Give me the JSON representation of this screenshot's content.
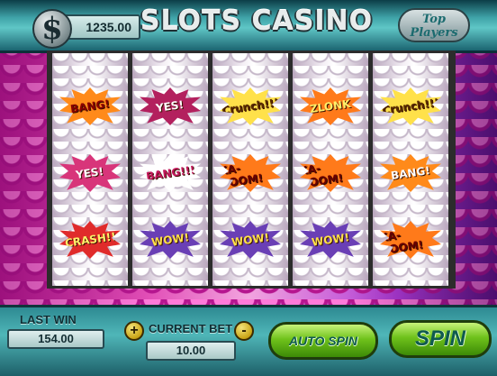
{
  "header": {
    "currency_symbol": "$",
    "balance": "1235.00",
    "title": "SLOTS CASINO",
    "top_players_line1": "Top",
    "top_players_line2": "Players"
  },
  "reels": [
    [
      {
        "text": "BANG!",
        "color": "#ff8a1a",
        "text_color": "#8a0000"
      },
      {
        "text": "YES!",
        "color": "#d8357a",
        "text_color": "#ffffff"
      },
      {
        "text": "CRASH!!",
        "color": "#e02b2b",
        "text_color": "#fff06a"
      }
    ],
    [
      {
        "text": "YES!",
        "color": "#b3205e",
        "text_color": "#ffffff"
      },
      {
        "text": "BANG!!!",
        "color": "#ffffff",
        "text_color": "#c2185b"
      },
      {
        "text": "WOW!",
        "color": "#6a3fb5",
        "text_color": "#ffe14a"
      }
    ],
    [
      {
        "text": "Crunch!!!",
        "color": "#ffe14a",
        "text_color": "#5a2d00"
      },
      {
        "text": "KA-BOOM!",
        "color": "#ff7a1a",
        "text_color": "#6a0000"
      },
      {
        "text": "WOW!",
        "color": "#6a3fb5",
        "text_color": "#ffe14a"
      }
    ],
    [
      {
        "text": "ZLONK",
        "color": "#ff7a1a",
        "text_color": "#fff06a"
      },
      {
        "text": "KA-BOOM!",
        "color": "#ff7a1a",
        "text_color": "#6a0000"
      },
      {
        "text": "WOW!",
        "color": "#6a3fb5",
        "text_color": "#ffe14a"
      }
    ],
    [
      {
        "text": "Crunch!!!",
        "color": "#ffe14a",
        "text_color": "#5a2d00"
      },
      {
        "text": "BANG!",
        "color": "#ff8a1a",
        "text_color": "#ffffff"
      },
      {
        "text": "KA-BOOM!",
        "color": "#ff7a1a",
        "text_color": "#6a0000"
      }
    ]
  ],
  "footer": {
    "last_win_label": "LAST WIN",
    "last_win_value": "154.00",
    "current_bet_label": "CURRENT BET",
    "current_bet_value": "10.00",
    "plus": "+",
    "minus": "-",
    "auto_spin": "AUTO SPIN",
    "spin": "SPIN"
  }
}
